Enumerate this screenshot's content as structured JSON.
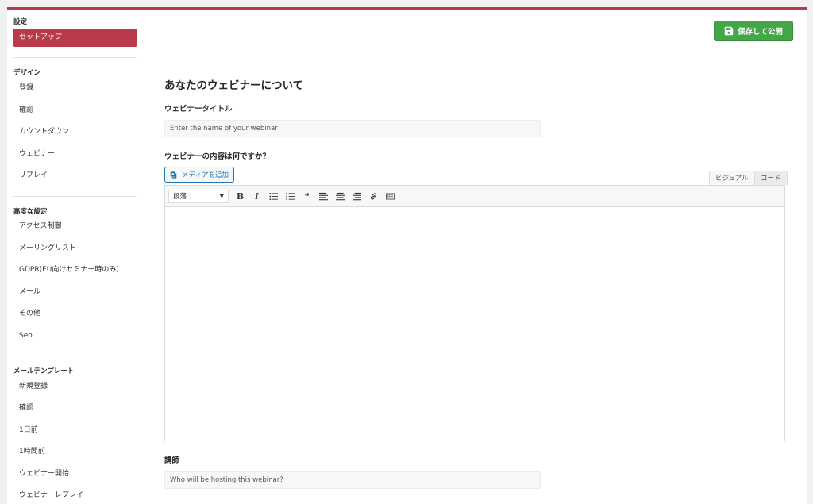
{
  "sidebar": {
    "settings_heading": "設定",
    "setup_item": "セットアップ",
    "design_heading": "デザイン",
    "design_items": [
      "登録",
      "確認",
      "カウントダウン",
      "ウェビナー",
      "リプレイ"
    ],
    "advanced_heading": "高度な設定",
    "advanced_items": [
      "アクセス制御",
      "メーリングリスト",
      "GDPR(EU向けセミナー時のみ)",
      "メール",
      "その他",
      "Seo"
    ],
    "mail_heading": "メールテンプレート",
    "mail_items": [
      "新規登録",
      "確認",
      "1日前",
      "1時間前",
      "ウェビナー開始",
      "ウェビナーレプレイ"
    ]
  },
  "header": {
    "publish_label": "保存して公開"
  },
  "main": {
    "title": "あなたのウェビナーについて",
    "webinar_title_label": "ウェビナータイトル",
    "webinar_title_placeholder": "Enter the name of your webinar",
    "content_label": "ウェビナーの内容は何ですか？",
    "add_media_label": "メディアを追加",
    "tab_visual": "ビジュアル",
    "tab_code": "コード",
    "format_select": "段落",
    "toolbar_bold": "B",
    "toolbar_italic": "I",
    "toolbar_quote": "❝",
    "presenter_label": "講師",
    "presenter_placeholder": "Who will be hosting this webinar?"
  },
  "colors": {
    "accent": "#b83a4b",
    "publish_green": "#44a648",
    "link_blue": "#2271b1"
  }
}
